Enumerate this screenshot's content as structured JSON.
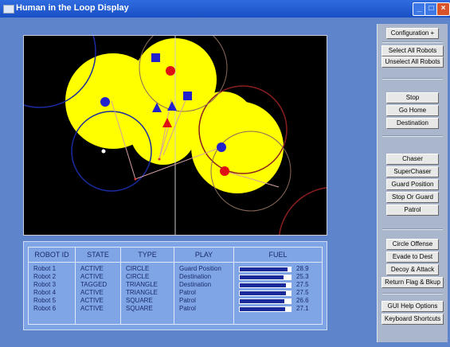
{
  "window": {
    "title": "Human in the Loop Display"
  },
  "sidebar": {
    "buttons": [
      "Configuration +",
      "Select All Robots",
      "Unselect All Robots",
      "Stop",
      "Go Home",
      "Destination",
      "Chaser",
      "SuperChaser",
      "Guard Position",
      "Stop Or Guard",
      "Patrol",
      "Circle Offense",
      "Evade to Dest",
      "Decoy & Attack",
      "Return Flag & Bkup",
      "GUI Help Options",
      "Keyboard Shortcuts"
    ]
  },
  "table": {
    "headers": {
      "id": "ROBOT ID",
      "state": "STATE",
      "type": "TYPE",
      "play": "PLAY",
      "fuel": "FUEL"
    },
    "rows": [
      {
        "id": "Robot 1",
        "state": "ACTIVE",
        "type": "CIRCLE",
        "play": "Guard Position",
        "fuel": "28.9",
        "level": 0.93
      },
      {
        "id": "Robot 2",
        "state": "ACTIVE",
        "type": "CIRCLE",
        "play": "Destination",
        "fuel": "25.3",
        "level": 0.86
      },
      {
        "id": "Robot 3",
        "state": "TAGGED",
        "type": "TRIANGLE",
        "play": "Destination",
        "fuel": "27.5",
        "level": 0.9
      },
      {
        "id": "Robot 4",
        "state": "ACTIVE",
        "type": "TRIANGLE",
        "play": "Patrol",
        "fuel": "27.5",
        "level": 0.9
      },
      {
        "id": "Robot 5",
        "state": "ACTIVE",
        "type": "SQUARE",
        "play": "Patrol",
        "fuel": "26.6",
        "level": 0.88
      },
      {
        "id": "Robot 6",
        "state": "ACTIVE",
        "type": "SQUARE",
        "play": "Patrol",
        "fuel": "27.1",
        "level": 0.89
      }
    ]
  },
  "colors": {
    "window": "#5e84cc",
    "coverage": "#ffff00",
    "robot_blue": "#2222cc",
    "enemy_red": "#dd1111",
    "map_bg": "#000000"
  },
  "icons": {
    "title": "window-icon",
    "minimize": "minimize-icon",
    "maximize": "maximize-icon",
    "close": "close-icon"
  }
}
